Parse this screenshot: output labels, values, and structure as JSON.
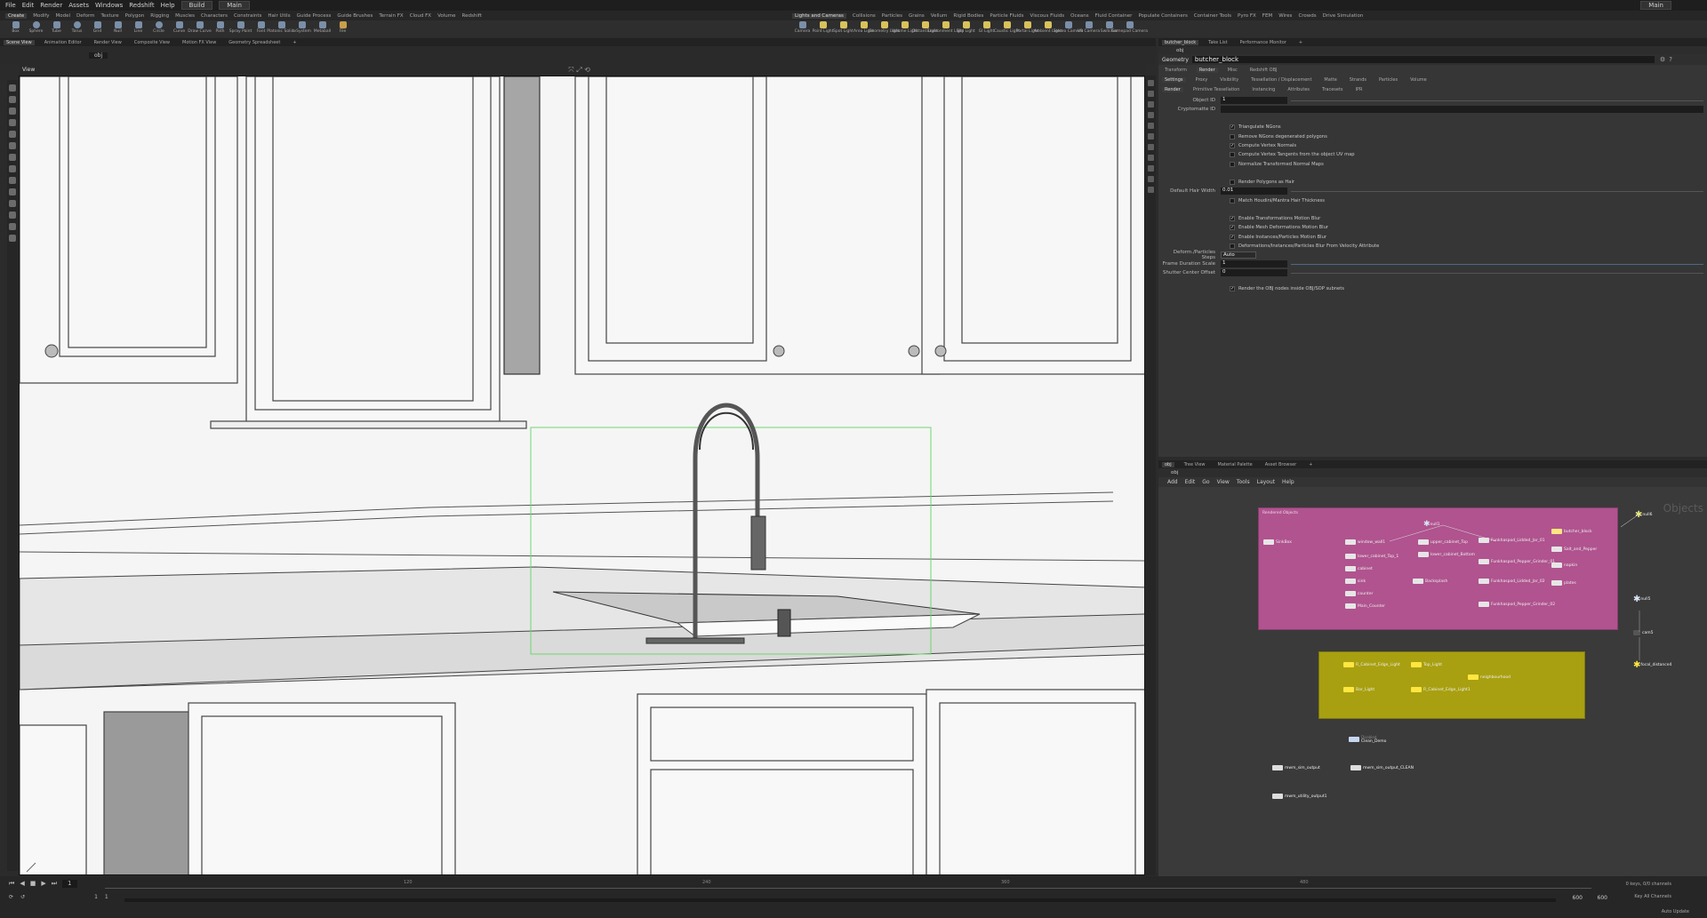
{
  "menubar": {
    "items": [
      "File",
      "Edit",
      "Render",
      "Assets",
      "Windows",
      "Redshift",
      "Help"
    ],
    "desktop": "Build",
    "network": "Main",
    "right_label": "Main"
  },
  "shelf_tabs_left": [
    "Create",
    "Modify",
    "Model",
    "Deform",
    "Texture",
    "Polygon",
    "Rigging",
    "Muscles",
    "Characters",
    "Constraints",
    "Hair Utils",
    "Guide Process",
    "Guide Brushes",
    "Terrain FX",
    "Cloud FX",
    "Volume",
    "Redshift"
  ],
  "shelf_tabs_right": [
    "Lights and Cameras",
    "Collisions",
    "Particles",
    "Grains",
    "Vellum",
    "Rigid Bodies",
    "Particle Fluids",
    "Viscous Fluids",
    "Oceans",
    "Fluid Container",
    "Populate Containers",
    "Container Tools",
    "Pyro FX",
    "FEM",
    "Wires",
    "Crowds",
    "Drive Simulation"
  ],
  "tools_left": [
    "Box",
    "Sphere",
    "Tube",
    "Torus",
    "Grid",
    "Null",
    "Line",
    "Circle",
    "Curve",
    "Draw Curve",
    "Path",
    "Spray Paint",
    "Font",
    "Platonic Solids",
    "L-System",
    "Metaball",
    "File"
  ],
  "tools_right": [
    "Camera",
    "Point Light",
    "Spot Light",
    "Area Light",
    "Geometry Light",
    "Volume Light",
    "Distant Light",
    "Environment Light",
    "Sky Light",
    "GI Light",
    "Caustic Light",
    "Portal Light",
    "Ambient Light",
    "Stereo Camera",
    "VR Camera",
    "Switcher",
    "Gamepad Camera"
  ],
  "pane_tabs_left": [
    "Scene View",
    "Animation Editor",
    "Render View",
    "Composite View",
    "Motion FX View",
    "Geometry Spreadsheet"
  ],
  "pane_tabs_params": [
    "butcher_block",
    "Take List",
    "Performance Monitor"
  ],
  "viewport": {
    "label": "View",
    "path": "obj"
  },
  "params": {
    "path": "obj",
    "type": "Geometry",
    "node_name": "butcher_block",
    "tabs1": [
      "Transform",
      "Render",
      "Misc",
      "Redshift OBJ"
    ],
    "tabs2": [
      "Settings",
      "Proxy",
      "Visibility",
      "Tessellation / Displacement",
      "Matte",
      "Strands",
      "Particles",
      "Volume"
    ],
    "tabs3": [
      "Render",
      "Primitive Tessellation",
      "Instancing",
      "Attributes",
      "Tracesets",
      "IPR"
    ],
    "object_id_label": "Object ID",
    "object_id": "1",
    "cryptomatte_label": "Cryptomatte ID",
    "checks1": [
      {
        "t": "Triangulate NGons",
        "c": true
      },
      {
        "t": "Remove NGons degenerated polygons",
        "c": false
      },
      {
        "t": "Compute Vertex Normals",
        "c": true
      },
      {
        "t": "Compute Vertex Tangents from the object UV map",
        "c": false
      },
      {
        "t": "Normalize Transformed Normal Maps",
        "c": false
      }
    ],
    "render_poly_hair": "Render Polygons as Hair",
    "hair_width_label": "Default Hair Width",
    "hair_width": "0.01",
    "match_hair": "Match Houdini/Mantra Hair Thickness",
    "checks2": [
      {
        "t": "Enable Transformations Motion Blur",
        "c": true
      },
      {
        "t": "Enable Mesh Deformations Motion Blur",
        "c": true
      },
      {
        "t": "Enable Instances/Particles Motion Blur",
        "c": true
      },
      {
        "t": "Deformations/Instances/Particles Blur From Velocity Attribute",
        "c": false
      }
    ],
    "steps_label": "Deform./Particles Steps",
    "steps": "Auto",
    "frame_scale_label": "Frame Duration Scale",
    "frame_scale": "1",
    "shutter_label": "Shutter Center Offset",
    "shutter": "0",
    "render_obj": "Render the OBJ nodes inside OBJ/SOP subnets"
  },
  "network": {
    "tabs": [
      "obj",
      "Tree View",
      "Material Palette",
      "Asset Browser"
    ],
    "path": "obj",
    "menu": [
      "Add",
      "Edit",
      "Go",
      "View",
      "Tools",
      "Layout",
      "Help"
    ],
    "context_label": "Objects",
    "box_pink": "Rendered Objects",
    "nodes_pink": [
      "SinkBox",
      "window_wall1",
      "lower_cabinet_Top_1",
      "cabinet",
      "sink",
      "counter",
      "Main_Counter",
      "null1",
      "upper_cabinet_Top",
      "lower_cabinet_Bottom",
      "Backsplash",
      "Funkhaspod_Lidded_Jar_01",
      "Funkhaspod_Pepper_Grinder_01",
      "Funkhaspod_Lidded_Jar_02",
      "Funkhaspod_Pepper_Grinder_02",
      "butcher_block",
      "Salt_and_Pepper",
      "napkin",
      "plates"
    ],
    "nodes_yellow": [
      "R_Cabinet_Edge_Light",
      "Top_Light",
      "Bar_Light",
      "R_Cabinet_Edge_Light1",
      "neighbourhood"
    ],
    "nodes_right": [
      "null6",
      "null5",
      "cam5",
      "focal_distance4"
    ],
    "nodes_misc": [
      "Clean_Demo",
      "mwm_sim_output",
      "mwm_sim_output_CLEAN",
      "mwm_utility_output1"
    ],
    "misc_note": "Disabled"
  },
  "timeline": {
    "frame": "1",
    "start": "1",
    "end": "1",
    "range_end": "600",
    "range_end2": "600",
    "ticks": [
      "120",
      "240",
      "360",
      "480"
    ],
    "keys": "0 keys, 0/0 channels",
    "all_channels": "Key All Channels",
    "auto_update": "Auto Update"
  }
}
